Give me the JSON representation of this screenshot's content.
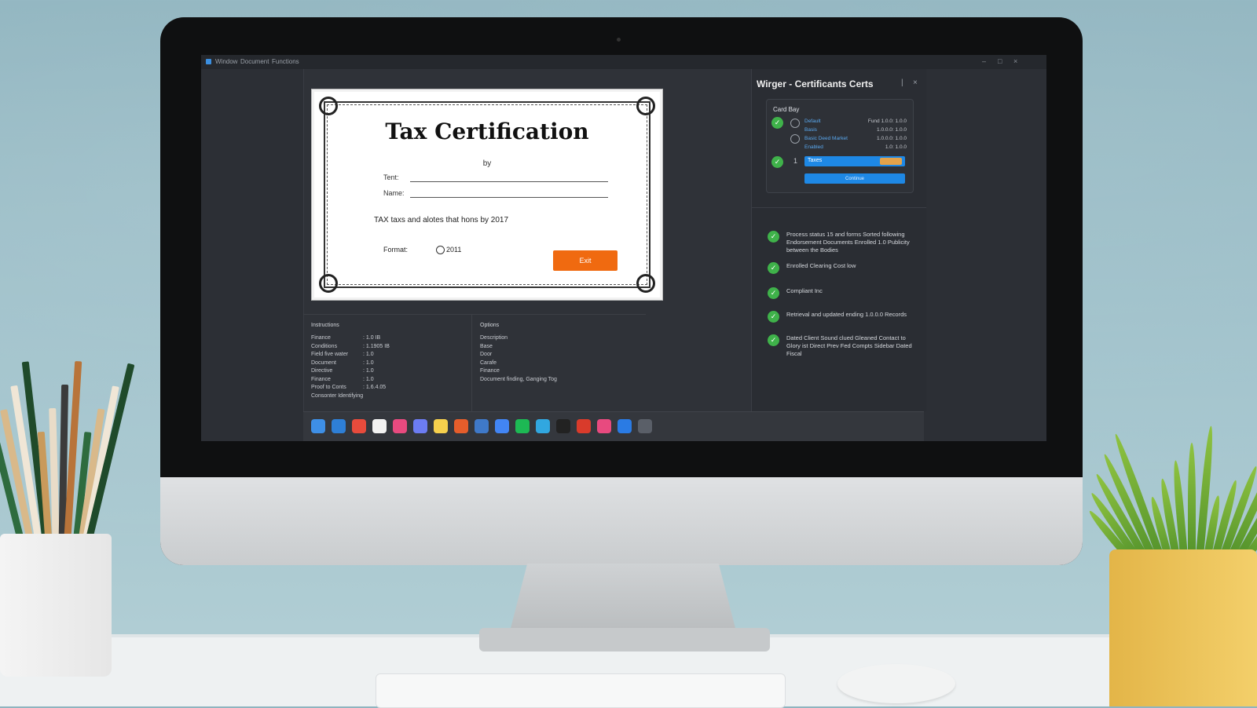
{
  "window": {
    "menus": [
      "Window",
      "Document",
      "Functions"
    ],
    "controls": [
      "–",
      "□",
      "×"
    ]
  },
  "certificate": {
    "title": "Tax Certification",
    "by": "by",
    "field_1_label": "Tent:",
    "field_2_label": "Name:",
    "body": "TAX taxs and alotes that hons by 2017",
    "format_label": "Format:",
    "radio_option": "2011",
    "button_label": "Exit"
  },
  "panels": {
    "left": {
      "heading": "Instructions",
      "rows": [
        {
          "k": "Finance",
          "v": ": 1.0 IB"
        },
        {
          "k": "Conditions",
          "v": ": 1.1905 IB"
        },
        {
          "k": "Field five water",
          "v": ": 1.0"
        },
        {
          "k": "Document",
          "v": ": 1.0"
        },
        {
          "k": "Directive",
          "v": ": 1.0"
        },
        {
          "k": "Finance",
          "v": ": 1.0"
        },
        {
          "k": "Proof to Conts",
          "v": ": 1.6.4.05"
        },
        {
          "k": "Consonter Identifying",
          "v": ""
        }
      ]
    },
    "right": {
      "heading": "Options",
      "rows": [
        "Description",
        "Base",
        "Door",
        "Carafe",
        "Finance",
        "Document finding, Ganging Tog"
      ]
    }
  },
  "widget": {
    "title": "Wirger - Certificants Certs",
    "card": {
      "heading": "Card Bay",
      "rows": [
        {
          "label": "Default",
          "value": "Fund 1.0.0: 1.0.0"
        },
        {
          "label": "Basis",
          "value": "1.0.0.0: 1.0.0"
        },
        {
          "label": "Basic Deed Market",
          "value": "1.0.0.0: 1.0.0"
        },
        {
          "label": "Enabled",
          "value": "1.0: 1.0.0"
        }
      ],
      "bar_label": "Taxes",
      "bar_number": "1",
      "button_label": "Continue"
    },
    "items": [
      "Process status 15 and forms Sorted following Endorsement Documents Enrolled 1.0 Publicity between the Bodies",
      "Enrolled Clearing Cost low",
      "Compliant Inc",
      "Retrieval and updated ending 1.0.0.0 Records",
      "Dated Client Sound clued Gleaned Contact to Glory ist Direct Prev Fed Compts Sidebar Dated Fiscal"
    ]
  },
  "taskbar": {
    "icons": [
      "start",
      "browser",
      "chrome",
      "notes",
      "photos",
      "files",
      "sticky",
      "maps",
      "mail",
      "chrome-2",
      "chat",
      "folder",
      "editor",
      "office",
      "music",
      "app",
      "terminal"
    ]
  },
  "colors": {
    "accent_orange": "#f06a10",
    "accent_blue": "#1e88e5",
    "check_green": "#3fb24a"
  }
}
